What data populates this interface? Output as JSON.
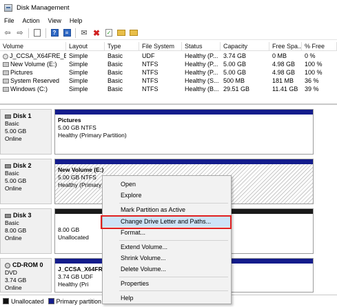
{
  "window": {
    "title": "Disk Management"
  },
  "menu": [
    "File",
    "Action",
    "View",
    "Help"
  ],
  "toolbar_icons": [
    "back-arrow-icon",
    "forward-arrow-icon",
    "console-tree-icon",
    "help-icon",
    "properties-icon",
    "connect-icon",
    "delete-icon",
    "check-icon",
    "open-folder-icon",
    "folder-icon"
  ],
  "volume_list": {
    "columns": [
      "Volume",
      "Layout",
      "Type",
      "File System",
      "Status",
      "Capacity",
      "Free Spa...",
      "% Free"
    ],
    "rows": [
      [
        "J_CCSA_X64FRE_E...",
        "Simple",
        "Basic",
        "UDF",
        "Healthy (P...",
        "3.74 GB",
        "0 MB",
        "0 %"
      ],
      [
        "New Volume (E:)",
        "Simple",
        "Basic",
        "NTFS",
        "Healthy (P...",
        "5.00 GB",
        "4.98 GB",
        "100 %"
      ],
      [
        "Pictures",
        "Simple",
        "Basic",
        "NTFS",
        "Healthy (P...",
        "5.00 GB",
        "4.98 GB",
        "100 %"
      ],
      [
        "System Reserved",
        "Simple",
        "Basic",
        "NTFS",
        "Healthy (S...",
        "500 MB",
        "181 MB",
        "36 %"
      ],
      [
        "Windows (C:)",
        "Simple",
        "Basic",
        "NTFS",
        "Healthy (B...",
        "29.51 GB",
        "11.41 GB",
        "39 %"
      ]
    ]
  },
  "disks": [
    {
      "name": "Disk 1",
      "type": "Basic",
      "size": "5.00 GB",
      "status": "Online",
      "partition": {
        "name": "Pictures",
        "detail": "5.00 GB NTFS",
        "status": "Healthy (Primary Partition)"
      }
    },
    {
      "name": "Disk 2",
      "type": "Basic",
      "size": "5.00 GB",
      "status": "Online",
      "partition": {
        "name": "New Volume  (E:)",
        "detail": "5.00 GB NTFS",
        "status": "Healthy (Primary"
      }
    },
    {
      "name": "Disk 3",
      "type": "Basic",
      "size": "8.00 GB",
      "status": "Online",
      "partition": {
        "size": "8.00 GB",
        "status": "Unallocated"
      }
    },
    {
      "name": "CD-ROM 0",
      "type": "DVD",
      "size": "3.74 GB",
      "status": "Online",
      "partition": {
        "name": "J_CCSA_X64FRE_E",
        "detail": "3.74 GB UDF",
        "status": "Healthy (Pri"
      }
    }
  ],
  "legend": {
    "unallocated": "Unallocated",
    "primary": "Primary partition"
  },
  "context_menu": {
    "items": [
      "Open",
      "Explore",
      "Mark Partition as Active",
      "Change Drive Letter and Paths...",
      "Format...",
      "Extend Volume...",
      "Shrink Volume...",
      "Delete Volume...",
      "Properties",
      "Help"
    ],
    "highlighted": "Change Drive Letter and Paths..."
  },
  "colors": {
    "primary_partition": "#131c8c",
    "unallocated": "#111111",
    "highlight_box": "#e02020"
  }
}
